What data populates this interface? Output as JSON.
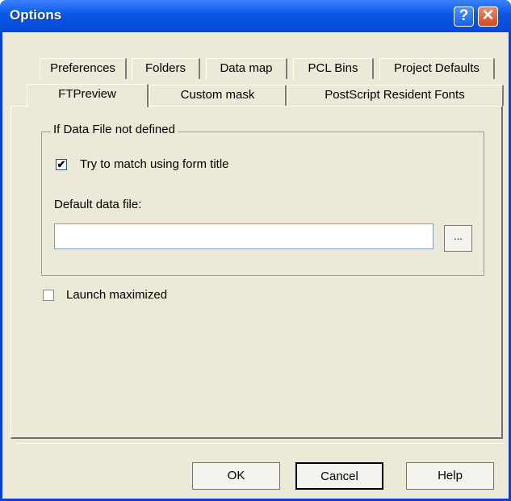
{
  "window": {
    "title": "Options"
  },
  "titlebar": {
    "help_glyph": "?",
    "close_glyph": "✕"
  },
  "tabs_row1": [
    {
      "label": "Preferences"
    },
    {
      "label": "Folders"
    },
    {
      "label": "Data map"
    },
    {
      "label": "PCL Bins"
    },
    {
      "label": "Project Defaults"
    }
  ],
  "tabs_row2": [
    {
      "label": "FTPreview",
      "active": true
    },
    {
      "label": "Custom mask"
    },
    {
      "label": "PostScript Resident Fonts"
    }
  ],
  "group": {
    "title": "If Data File not defined",
    "try_match": {
      "label": "Try to match using form title",
      "checked": true
    },
    "default_data_file_label": "Default data file:",
    "default_data_file_value": "",
    "browse_label": "..."
  },
  "launch_maximized": {
    "label": "Launch maximized",
    "checked": false
  },
  "buttons": {
    "ok": "OK",
    "cancel": "Cancel",
    "help": "Help"
  }
}
